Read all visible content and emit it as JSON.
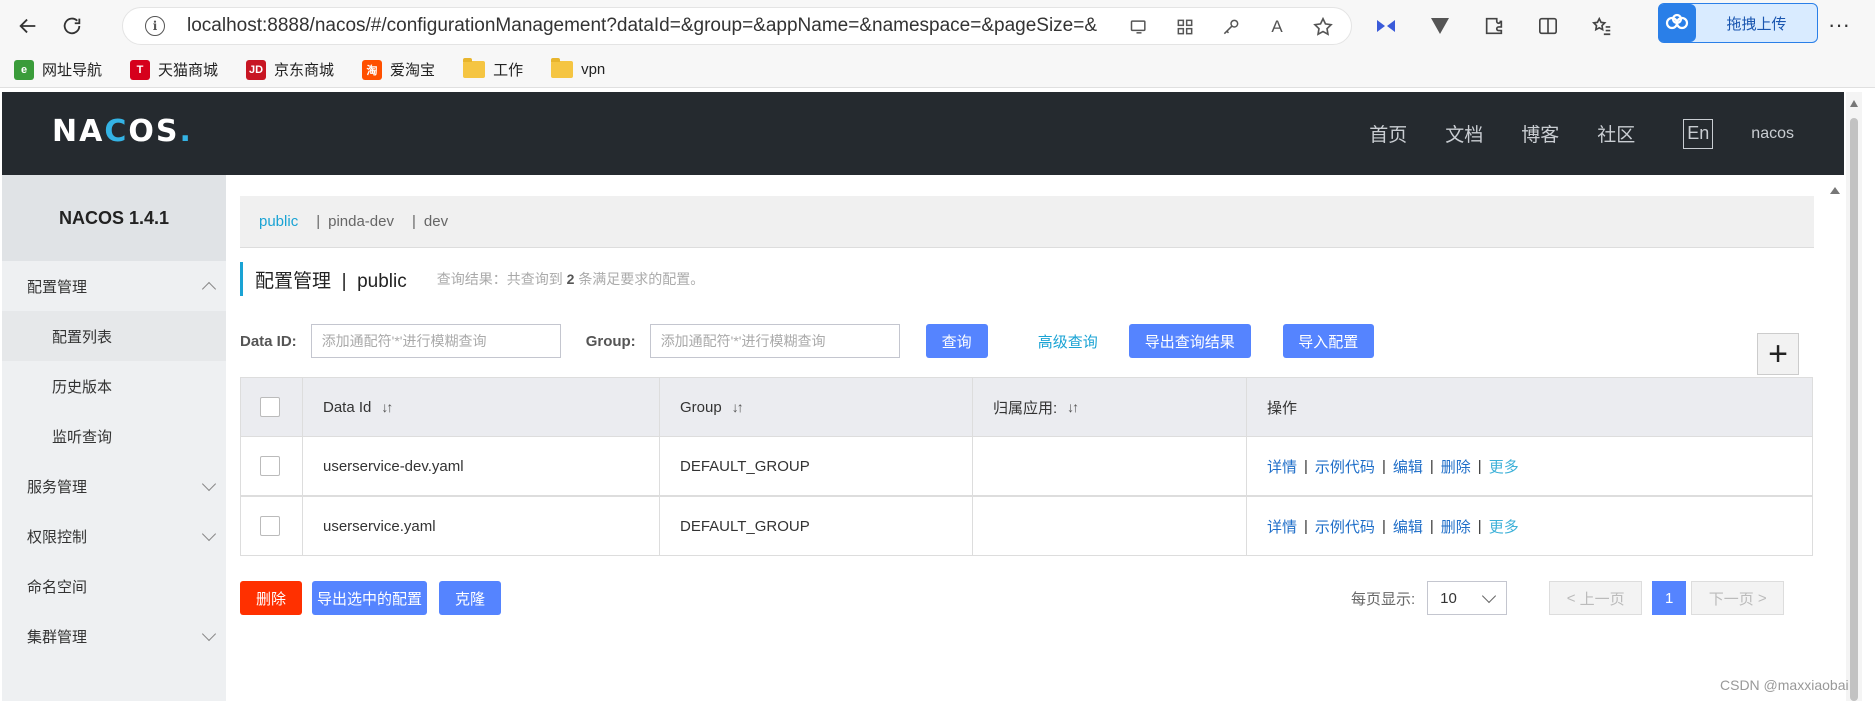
{
  "browser": {
    "url": "localhost:8888/nacos/#/configurationManagement?dataId=&group=&appName=&namespace=&pageSize=&page...",
    "upload_label": "拖拽上传"
  },
  "bookmarks": [
    {
      "label": "网址导航",
      "color": "#3a9c3a",
      "mark": "e"
    },
    {
      "label": "天猫商城",
      "color": "#d6001c",
      "mark": "T"
    },
    {
      "label": "京东商城",
      "color": "#c81623",
      "mark": "JD"
    },
    {
      "label": "爱淘宝",
      "color": "#ff5000",
      "mark": "淘"
    },
    {
      "label": "工作",
      "color": "",
      "mark": ""
    },
    {
      "label": "vpn",
      "color": "",
      "mark": ""
    }
  ],
  "header": {
    "logo_text": "NACOS.",
    "nav": [
      "首页",
      "文档",
      "博客",
      "社区"
    ],
    "lang": "En",
    "user": "nacos"
  },
  "sidebar": {
    "title": "NACOS 1.4.1",
    "items": [
      {
        "label": "配置管理",
        "type": "group",
        "expanded": true
      },
      {
        "label": "配置列表",
        "type": "sub",
        "active": true
      },
      {
        "label": "历史版本",
        "type": "sub"
      },
      {
        "label": "监听查询",
        "type": "sub"
      },
      {
        "label": "服务管理",
        "type": "group",
        "expanded": false
      },
      {
        "label": "权限控制",
        "type": "group",
        "expanded": false
      },
      {
        "label": "命名空间",
        "type": "plain"
      },
      {
        "label": "集群管理",
        "type": "group",
        "expanded": false
      }
    ]
  },
  "namespaces": [
    "public",
    "pinda-dev",
    "dev"
  ],
  "page": {
    "title": "配置管理",
    "namespace": "public",
    "result_prefix": "查询结果：共查询到",
    "result_count": "2",
    "result_suffix": "条满足要求的配置。"
  },
  "search": {
    "dataid_label": "Data ID:",
    "dataid_placeholder": "添加通配符'*'进行模糊查询",
    "group_label": "Group:",
    "group_placeholder": "添加通配符'*'进行模糊查询",
    "query_button": "查询",
    "advanced_link": "高级查询",
    "export_button": "导出查询结果",
    "import_button": "导入配置",
    "add_button": "+"
  },
  "table": {
    "columns": [
      "Data Id",
      "Group",
      "归属应用:",
      "操作"
    ],
    "rows": [
      {
        "data_id": "userservice-dev.yaml",
        "group": "DEFAULT_GROUP",
        "app": ""
      },
      {
        "data_id": "userservice.yaml",
        "group": "DEFAULT_GROUP",
        "app": ""
      }
    ],
    "ops": [
      "详情",
      "示例代码",
      "编辑",
      "删除",
      "更多"
    ]
  },
  "footer": {
    "delete_button": "删除",
    "export_selected_button": "导出选中的配置",
    "clone_button": "克隆",
    "page_size_label": "每页显示:",
    "page_size": "10",
    "prev": "上一页",
    "current_page": "1",
    "next": "下一页"
  },
  "watermark": "CSDN @maxxiaobai",
  "colors": {
    "header_bg": "#252a2f",
    "accent": "#1aa3d4",
    "primary_button": "#5584ff",
    "danger_button": "#ff3000"
  }
}
